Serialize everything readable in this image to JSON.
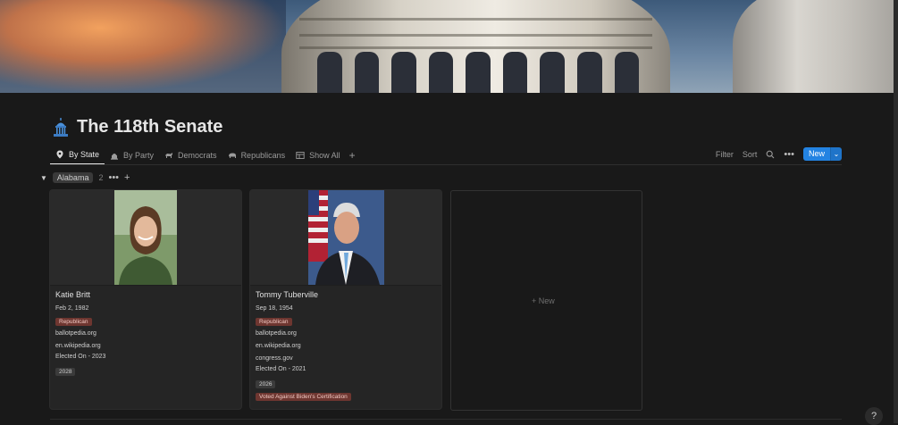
{
  "page": {
    "title": "The 118th Senate",
    "icon": "capitol-icon"
  },
  "tabs": [
    {
      "label": "By State",
      "icon": "map-pin-icon",
      "active": true
    },
    {
      "label": "By Party",
      "icon": "capitol-outline-icon"
    },
    {
      "label": "Democrats",
      "icon": "donkey-icon"
    },
    {
      "label": "Republicans",
      "icon": "elephant-icon"
    },
    {
      "label": "Show All",
      "icon": "table-icon"
    }
  ],
  "toolbar": {
    "filter": "Filter",
    "sort": "Sort",
    "new": "New"
  },
  "group": {
    "name": "Alabama",
    "count": "2"
  },
  "cards": [
    {
      "name": "Katie Britt",
      "birth": "Feb 2, 1982",
      "party": "Republican",
      "link1": "ballotpedia.org",
      "link2": "en.wikipedia.org",
      "elected": "Elected On - 2023",
      "term": "2028"
    },
    {
      "name": "Tommy Tuberville",
      "birth": "Sep 18, 1954",
      "party": "Republican",
      "link1": "ballotpedia.org",
      "link2": "en.wikipedia.org",
      "link3": "congress.gov",
      "elected": "Elected On - 2021",
      "term": "2026",
      "note": "Voted Against Biden's Certification"
    }
  ],
  "new_card": "New",
  "help": "?",
  "colors": {
    "accent": "#2383e2",
    "republican_tag": "#6e3630",
    "background": "#191919"
  }
}
